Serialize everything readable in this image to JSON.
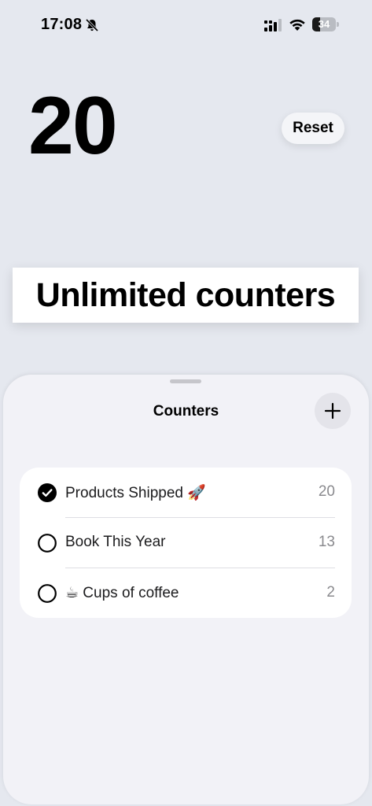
{
  "status_bar": {
    "time": "17:08",
    "battery_level": "34",
    "battery_fraction": 0.34
  },
  "main": {
    "count": "20",
    "reset_label": "Reset"
  },
  "promo": {
    "text": "Unlimited counters"
  },
  "sheet": {
    "title": "Counters",
    "counters": [
      {
        "label": "Products Shipped 🚀",
        "value": "20",
        "selected": true
      },
      {
        "label": "Book This Year",
        "value": "13",
        "selected": false
      },
      {
        "label": "☕ Cups of coffee",
        "value": "2",
        "selected": false
      }
    ]
  },
  "colors": {
    "background": "#e5e8ef",
    "sheet": "#f2f2f7",
    "secondary_text": "#8a8a8e"
  }
}
